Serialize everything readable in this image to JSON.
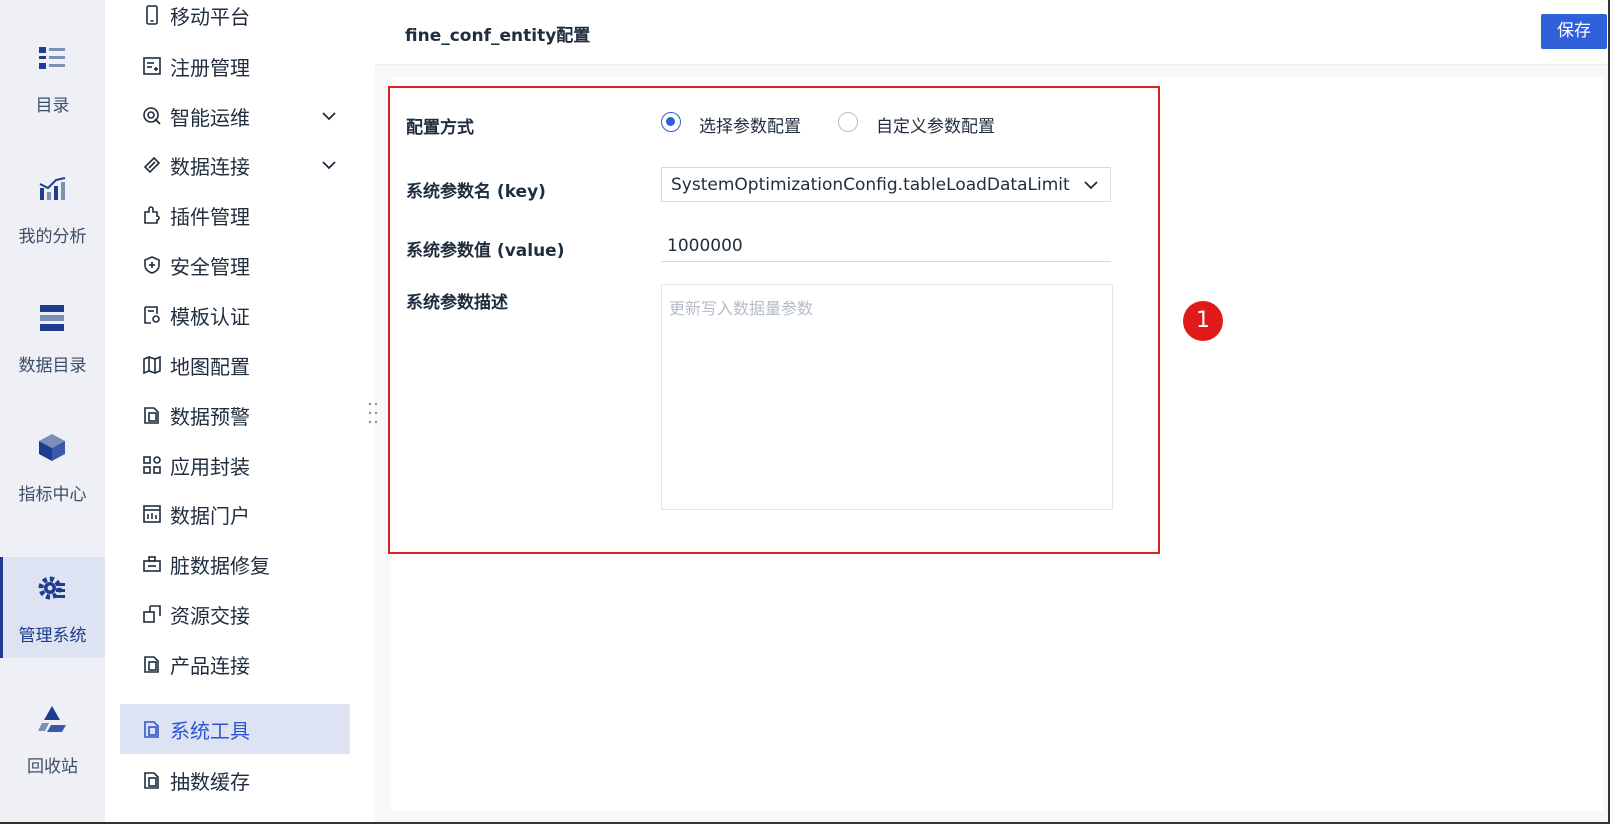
{
  "rail": {
    "items": [
      {
        "label": "目录",
        "icon": "list-icon"
      },
      {
        "label": "我的分析",
        "icon": "analysis-chart-icon"
      },
      {
        "label": "数据目录",
        "icon": "data-catalog-icon"
      },
      {
        "label": "指标中心",
        "icon": "cube-icon"
      },
      {
        "label": "管理系统",
        "icon": "gear-icon"
      },
      {
        "label": "回收站",
        "icon": "recycle-icon"
      }
    ],
    "active": "管理系统"
  },
  "menu": {
    "items": [
      {
        "label": "移动平台",
        "icon": "mobile-icon"
      },
      {
        "label": "注册管理",
        "icon": "register-icon"
      },
      {
        "label": "智能运维",
        "icon": "ops-icon"
      },
      {
        "label": "数据连接",
        "icon": "link-icon"
      },
      {
        "label": "插件管理",
        "icon": "plugin-icon"
      },
      {
        "label": "安全管理",
        "icon": "shield-icon"
      },
      {
        "label": "模板认证",
        "icon": "template-cert-icon"
      },
      {
        "label": "地图配置",
        "icon": "map-icon"
      },
      {
        "label": "数据预警",
        "icon": "copy-icon"
      },
      {
        "label": "应用封装",
        "icon": "apps-icon"
      },
      {
        "label": "数据门户",
        "icon": "portal-icon"
      },
      {
        "label": "脏数据修复",
        "icon": "repair-icon"
      },
      {
        "label": "资源交接",
        "icon": "handover-icon"
      },
      {
        "label": "产品连接",
        "icon": "copy-icon"
      },
      {
        "label": "系统工具",
        "icon": "copy-icon"
      },
      {
        "label": "抽数缓存",
        "icon": "copy-icon"
      }
    ],
    "active": "系统工具"
  },
  "header": {
    "title": "fine_conf_entity配置",
    "save_label": "保存"
  },
  "form": {
    "mode_label": "配置方式",
    "mode_options": [
      "选择参数配置",
      "自定义参数配置"
    ],
    "mode_selected": "选择参数配置",
    "key_label": "系统参数名 (key)",
    "key_value": "SystemOptimizationConfig.tableLoadDataLimit",
    "value_label": "系统参数值 (value)",
    "value_value": "1000000",
    "desc_label": "系统参数描述",
    "desc_placeholder": "更新写入数据量参数"
  },
  "annotation": {
    "badge": "1",
    "color": "#e01919"
  },
  "colors": {
    "accent": "#2f5fd9",
    "rail_bg": "#eef0f5",
    "highlight_border": "#e02020"
  }
}
